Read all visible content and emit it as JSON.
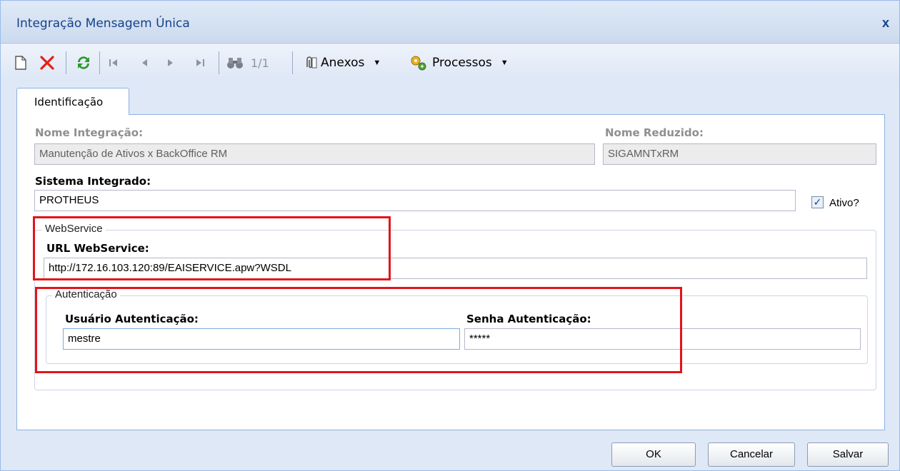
{
  "window": {
    "title": "Integração Mensagem Única",
    "close": "x"
  },
  "toolbar": {
    "record_counter": "1/1",
    "attachments_label": "Anexos",
    "processes_label": "Processos",
    "dropdown_arrow": "▼"
  },
  "tabs": [
    {
      "label": "Identificação",
      "active": true
    }
  ],
  "form": {
    "nome_integracao": {
      "label": "Nome Integração:",
      "value": "Manutenção de Ativos x BackOffice RM"
    },
    "nome_reduzido": {
      "label": "Nome Reduzido:",
      "value": "SIGAMNTxRM"
    },
    "sistema_integrado": {
      "label": "Sistema Integrado:",
      "value": "PROTHEUS"
    },
    "ativo": {
      "label": "Ativo?",
      "checked": true,
      "mark": "✓"
    },
    "webservice": {
      "legend": "WebService",
      "url_label": "URL WebService:",
      "url_value": "http://172.16.103.120:89/EAISERVICE.apw?WSDL"
    },
    "autenticacao": {
      "legend": "Autenticação",
      "usuario_label": "Usuário Autenticação:",
      "usuario_value": "mestre",
      "senha_label": "Senha Autenticação:",
      "senha_value": "*****"
    }
  },
  "buttons": {
    "ok": "OK",
    "cancel": "Cancelar",
    "save": "Salvar"
  },
  "colors": {
    "highlight": "#e3141b",
    "title": "#15428b",
    "background": "#dfe8f6"
  }
}
